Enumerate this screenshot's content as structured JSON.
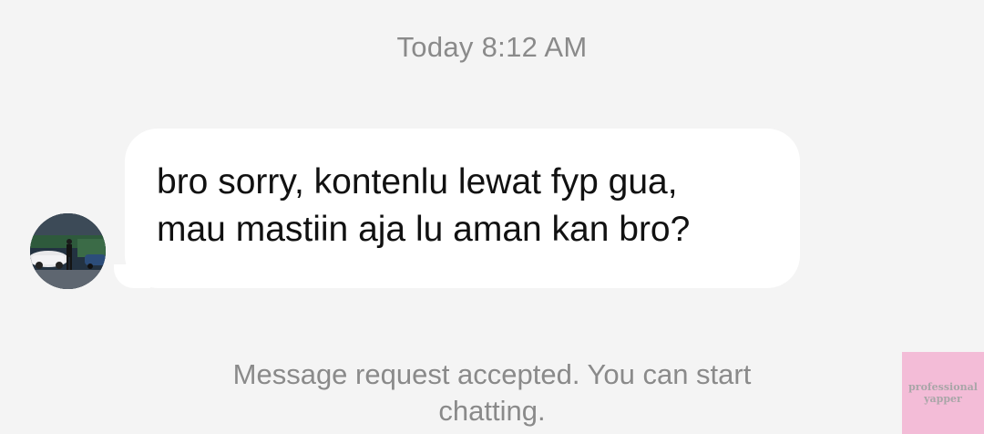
{
  "header": {
    "timestamp": "Today 8:12 AM"
  },
  "message": {
    "sender_avatar_icon": "profile-avatar-photo",
    "lines": [
      "bro sorry, kontenlu lewat fyp gua,",
      "mau mastiin aja lu aman kan bro?"
    ]
  },
  "system_note": {
    "lines": [
      "Message request accepted. You can start",
      "chatting."
    ]
  },
  "watermark": {
    "lines": [
      "professional",
      "yapper"
    ],
    "color": "#f3bcd7"
  },
  "colors": {
    "background": "#f4f4f4",
    "bubble": "#ffffff",
    "muted_text": "#8a8a8a",
    "message_text": "#111111"
  }
}
